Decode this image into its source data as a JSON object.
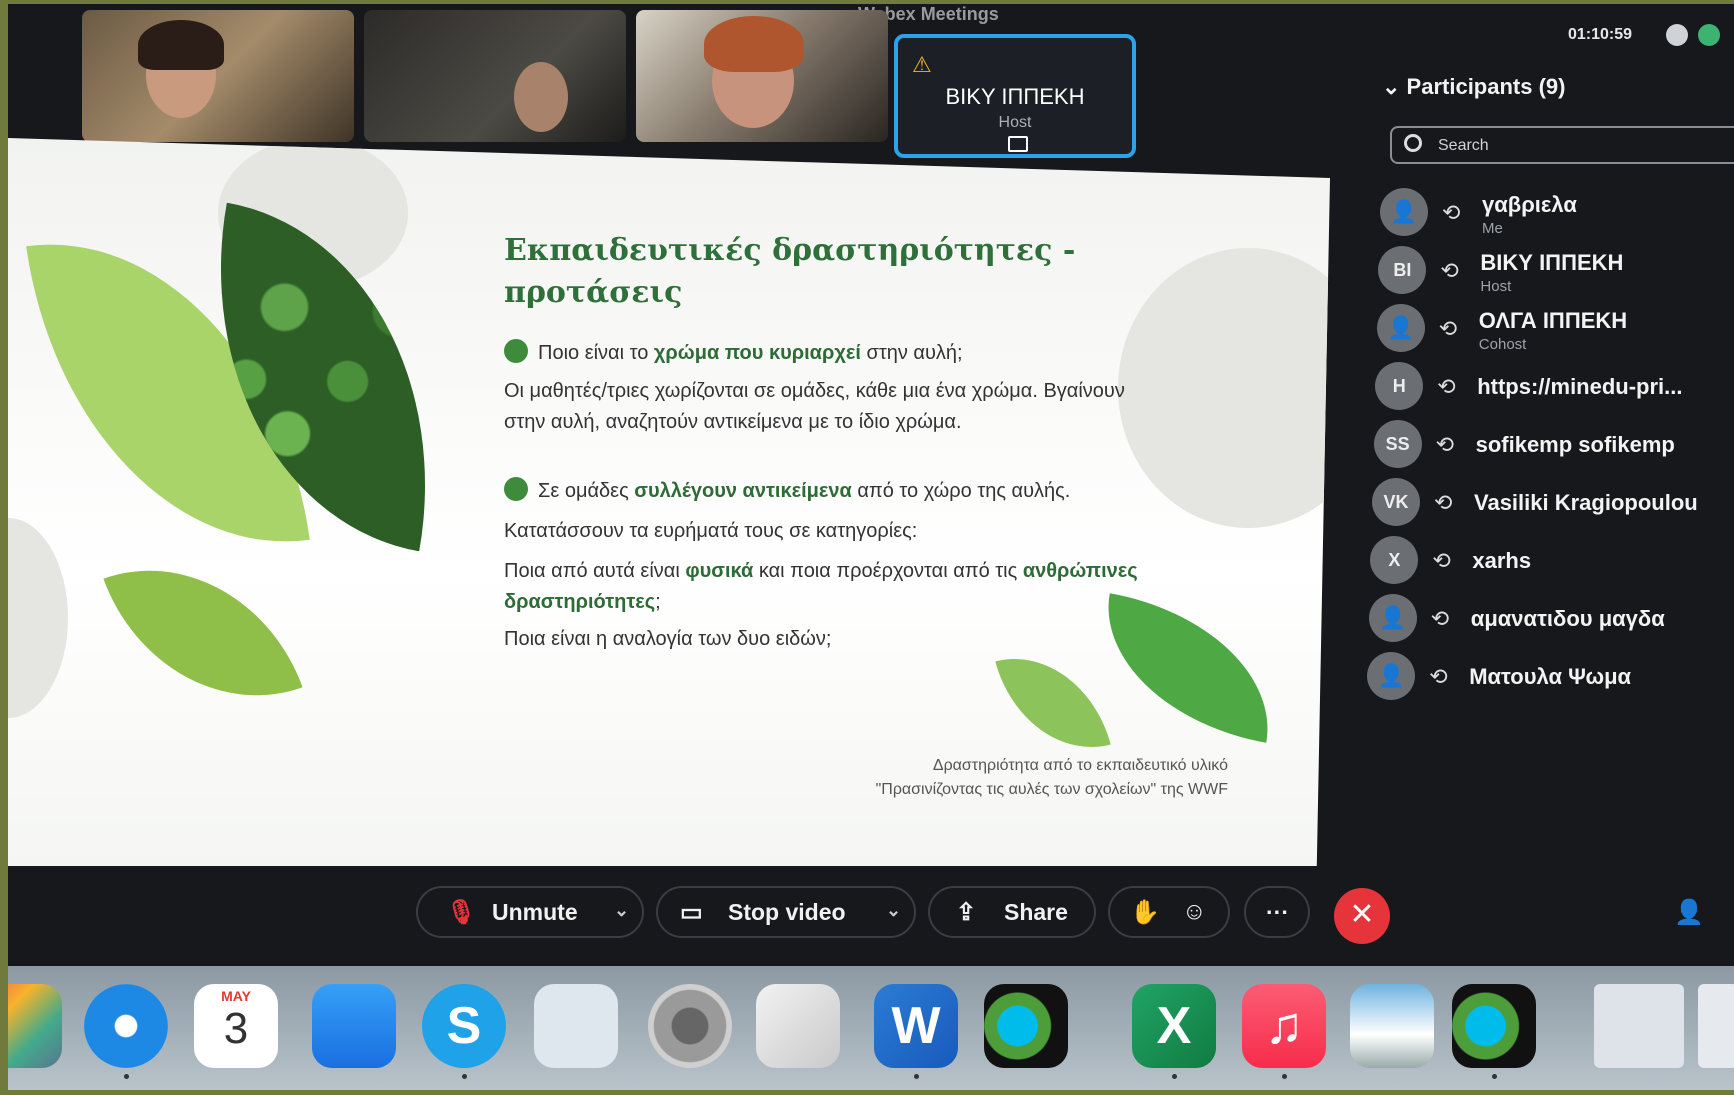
{
  "app": {
    "title": "Webex Meetings"
  },
  "video_tiles": [
    {
      "type": "camera"
    },
    {
      "type": "camera"
    },
    {
      "type": "camera"
    },
    {
      "type": "avatar",
      "name": "ΒΙΚΥ ΙΠΠΕΚΗ",
      "role": "Host"
    }
  ],
  "clock": "01:10:59",
  "participants_panel": {
    "header": "Participants (9)",
    "search_placeholder": "Search",
    "items": [
      {
        "initials": "",
        "name": "γαβριελα",
        "role": "Me"
      },
      {
        "initials": "BI",
        "name": "ΒΙΚΥ ΙΠΠΕΚΗ",
        "role": "Host"
      },
      {
        "initials": "",
        "name": "ΟΛΓΑ ΙΠΠΕΚΗ",
        "role": "Cohost"
      },
      {
        "initials": "H",
        "name": "https://minedu-pri...",
        "role": ""
      },
      {
        "initials": "SS",
        "name": "sofikemp sofikemp",
        "role": ""
      },
      {
        "initials": "VK",
        "name": "Vasiliki Kragiopoulou",
        "role": ""
      },
      {
        "initials": "X",
        "name": "xarhs",
        "role": ""
      },
      {
        "initials": "",
        "name": "αμανατιδου μαγδα",
        "role": ""
      },
      {
        "initials": "",
        "name": "Ματουλα Ψωμα",
        "role": ""
      }
    ]
  },
  "slide": {
    "title": "Εκπαιδευτικές δραστηριότητες - προτάσεις",
    "b1_pre": "Ποιο είναι το ",
    "b1_bold": "χρώμα που κυριαρχεί",
    "b1_post": " στην αυλή;",
    "p1": "Οι μαθητές/τριες χωρίζονται σε ομάδες, κάθε μια ένα χρώμα. Βγαίνουν στην αυλή, αναζητούν αντικείμενα με το ίδιο χρώμα.",
    "b2_pre": "Σε ομάδες ",
    "b2_bold": "συλλέγουν αντικείμενα",
    "b2_post": " από το χώρο της αυλής.",
    "p2": "Κατατάσσουν τα ευρήματά τους σε κατηγορίες:",
    "p3_pre": "Ποια από αυτά είναι ",
    "p3_bold1": "φυσικά",
    "p3_mid": " και ποια προέρχονται από τις ",
    "p3_bold2": "ανθρώπινες δραστηριότητες",
    "p3_post": ";",
    "p4": "Ποια είναι η αναλογία των δυο ειδών;",
    "credit1": "Δραστηριότητα από το εκπαιδευτικό υλικό",
    "credit2": "\"Πρασινίζοντας τις αυλές των σχολείων\" της WWF"
  },
  "controls": {
    "unmute": "Unmute",
    "stop_video": "Stop video",
    "share": "Share",
    "more": "···",
    "end": "✕"
  },
  "dock": {
    "calendar_month": "MAY",
    "calendar_day": "3",
    "word_letter": "W",
    "excel_letter": "X",
    "skype_letter": "S"
  },
  "colors": {
    "accent_blue": "#2ea2e6",
    "end_red": "#e5353a",
    "slide_green": "#2f6f39"
  }
}
